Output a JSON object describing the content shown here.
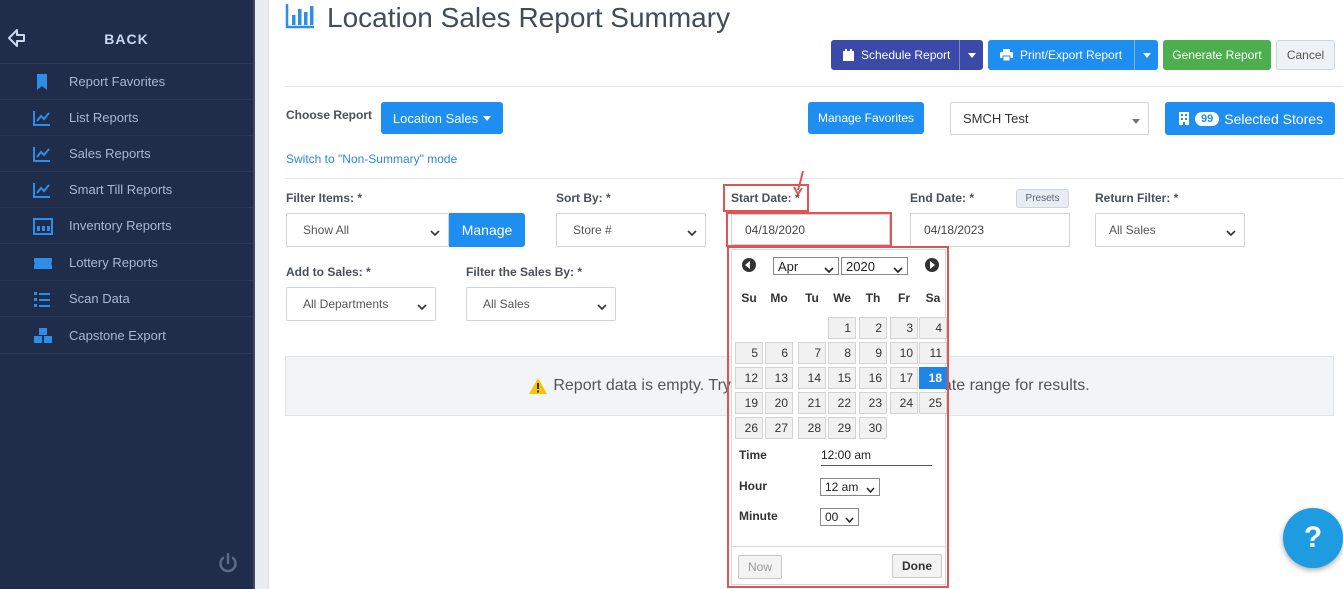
{
  "sidebar": {
    "back_label": "BACK",
    "items": [
      {
        "label": "Report Favorites",
        "icon": "bookmark-icon"
      },
      {
        "label": "List Reports",
        "icon": "line-chart-icon"
      },
      {
        "label": "Sales Reports",
        "icon": "line-chart-icon"
      },
      {
        "label": "Smart Till Reports",
        "icon": "line-chart-icon"
      },
      {
        "label": "Inventory Reports",
        "icon": "inventory-icon"
      },
      {
        "label": "Lottery Reports",
        "icon": "ticket-icon"
      },
      {
        "label": "Scan Data",
        "icon": "list-icon"
      },
      {
        "label": "Capstone Export",
        "icon": "boxes-icon"
      }
    ]
  },
  "header": {
    "title": "Location Sales Report Summary",
    "schedule_label": "Schedule Report",
    "print_label": "Print/Export Report",
    "generate_label": "Generate Report",
    "cancel_label": "Cancel"
  },
  "choose": {
    "label": "Choose Report",
    "report_value": "Location Sales",
    "favorites_label": "Manage Favorites",
    "store_value": "SMCH Test",
    "selected_count": "99",
    "selected_label": "Selected Stores",
    "switch_link": "Switch to \"Non-Summary\" mode"
  },
  "filters": {
    "filter_items_label": "Filter Items: *",
    "filter_items_value": "Show All",
    "manage_label": "Manage",
    "sort_by_label": "Sort By: *",
    "sort_by_value": "Store #",
    "start_date_label": "Start Date: *",
    "start_date_value": "04/18/2020",
    "end_date_label": "End Date: *",
    "presets_label": "Presets",
    "end_date_value": "04/18/2023",
    "return_filter_label": "Return Filter: *",
    "return_filter_value": "All Sales",
    "add_to_sales_label": "Add to Sales: *",
    "add_to_sales_value": "All Departments",
    "filter_sales_by_label": "Filter the Sales By: *",
    "filter_sales_by_value": "All Sales"
  },
  "empty_message_left": "Report data is empty. Try",
  "empty_message_right": "ate range for results.",
  "datepicker": {
    "month": "Apr",
    "year": "2020",
    "weekdays": [
      "Su",
      "Mo",
      "Tu",
      "We",
      "Th",
      "Fr",
      "Sa"
    ],
    "days": [
      "1",
      "2",
      "3",
      "4",
      "5",
      "6",
      "7",
      "8",
      "9",
      "10",
      "11",
      "12",
      "13",
      "14",
      "15",
      "16",
      "17",
      "18",
      "19",
      "20",
      "21",
      "22",
      "23",
      "24",
      "25",
      "26",
      "27",
      "28",
      "29",
      "30"
    ],
    "selected_day": "18",
    "time_label": "Time",
    "time_value": "12:00 am",
    "hour_label": "Hour",
    "hour_value": "12 am",
    "minute_label": "Minute",
    "minute_value": "00",
    "now_label": "Now",
    "done_label": "Done"
  },
  "help_label": "?",
  "colors": {
    "sidebar_bg": "#1f2d4b",
    "primary_blue": "#1f8ef1",
    "schedule_navy": "#3b4aa8",
    "success_green": "#4cae4c",
    "highlight_red": "#e25454"
  }
}
